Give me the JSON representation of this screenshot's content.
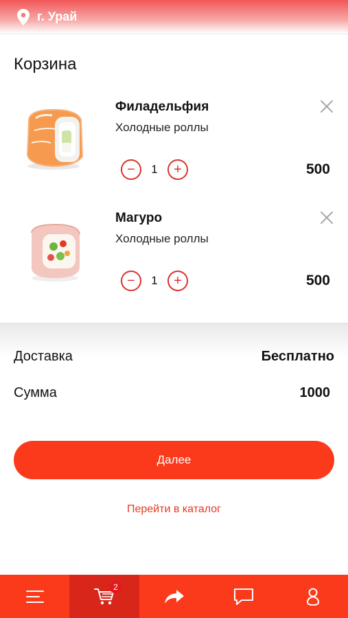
{
  "location": {
    "city": "г. Урай"
  },
  "cart": {
    "title": "Корзина",
    "items": [
      {
        "name": "Филадельфия",
        "category": "Холодные роллы",
        "quantity": "1",
        "price": "500",
        "minus": "−",
        "plus": "+"
      },
      {
        "name": "Магуро",
        "category": "Холодные роллы",
        "quantity": "1",
        "price": "500",
        "minus": "−",
        "plus": "+"
      }
    ]
  },
  "summary": {
    "delivery_label": "Доставка",
    "delivery_value": "Бесплатно",
    "total_label": "Сумма",
    "total_value": "1000"
  },
  "actions": {
    "next_label": "Далее",
    "catalog_link": "Перейти в каталог"
  },
  "bottom_nav": {
    "items": [
      "menu-icon",
      "cart-icon",
      "share-icon",
      "chat-icon",
      "profile-icon"
    ],
    "cart_badge": "2"
  },
  "colors": {
    "accent": "#fb3a1c",
    "accent_dark": "#d8261b",
    "link": "#e33a22"
  }
}
